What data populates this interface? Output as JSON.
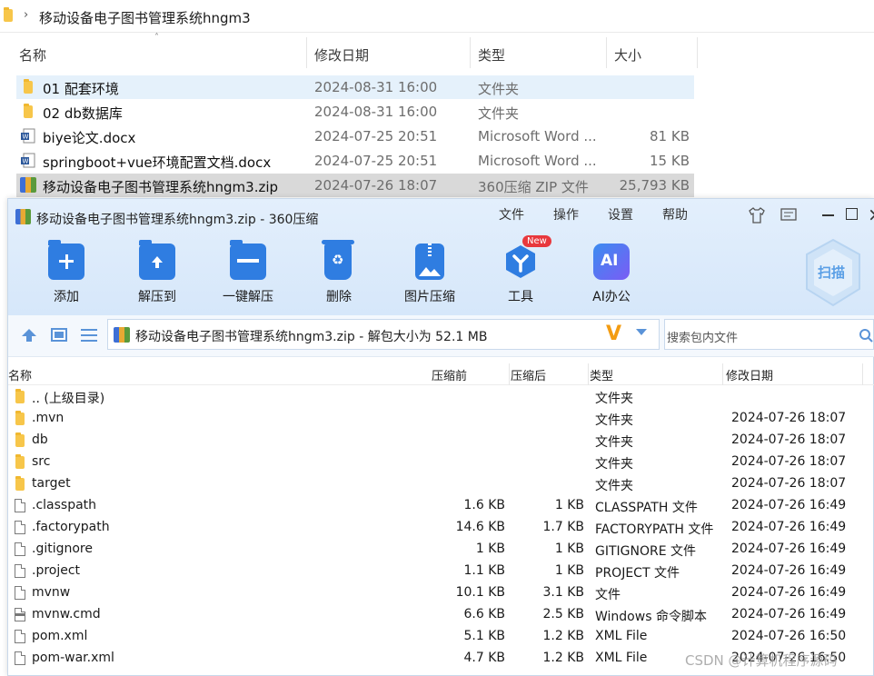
{
  "explorer": {
    "path": "移动设备电子图书管理系统hngm3",
    "columns": {
      "name": "名称",
      "date": "修改日期",
      "type": "类型",
      "size": "大小"
    },
    "rows": [
      {
        "name": "01 配套环境",
        "date": "2024-08-31 16:00",
        "type": "文件夹",
        "size": ""
      },
      {
        "name": "02 db数据库",
        "date": "2024-08-31 16:00",
        "type": "文件夹",
        "size": ""
      },
      {
        "name": "biye论文.docx",
        "date": "2024-07-25 20:51",
        "type": "Microsoft Word ...",
        "size": "81 KB"
      },
      {
        "name": "springboot+vue环境配置文档.docx",
        "date": "2024-07-25 20:51",
        "type": "Microsoft Word ...",
        "size": "15 KB"
      },
      {
        "name": "移动设备电子图书管理系统hngm3.zip",
        "date": "2024-07-26 18:07",
        "type": "360压缩 ZIP 文件",
        "size": "25,793 KB"
      }
    ]
  },
  "app": {
    "title": "移动设备电子图书管理系统hngm3.zip - 360压缩",
    "menu": [
      "文件",
      "操作",
      "设置",
      "帮助"
    ],
    "toolbar": [
      {
        "label": "添加",
        "icon": "add-icon"
      },
      {
        "label": "解压到",
        "icon": "extract-to-icon"
      },
      {
        "label": "一键解压",
        "icon": "one-click-extract-icon"
      },
      {
        "label": "删除",
        "icon": "delete-icon"
      },
      {
        "label": "图片压缩",
        "icon": "image-compress-icon"
      },
      {
        "label": "工具",
        "icon": "tools-icon",
        "badge": "New"
      },
      {
        "label": "AI办公",
        "icon": "ai-office-icon",
        "glyph": "AI"
      }
    ],
    "scan_label": "扫描",
    "address": "移动设备电子图书管理系统hngm3.zip - 解包大小为 52.1 MB",
    "search_placeholder": "搜索包内文件",
    "columns": {
      "name": "名称",
      "before": "压缩前",
      "after": "压缩后",
      "type": "类型",
      "date": "修改日期"
    },
    "rows": [
      {
        "name": ".. (上级目录)",
        "before": "",
        "after": "",
        "type": "文件夹",
        "date": "",
        "kind": "folder"
      },
      {
        "name": ".mvn",
        "before": "",
        "after": "",
        "type": "文件夹",
        "date": "2024-07-26 18:07",
        "kind": "folder"
      },
      {
        "name": "db",
        "before": "",
        "after": "",
        "type": "文件夹",
        "date": "2024-07-26 18:07",
        "kind": "folder"
      },
      {
        "name": "src",
        "before": "",
        "after": "",
        "type": "文件夹",
        "date": "2024-07-26 18:07",
        "kind": "folder"
      },
      {
        "name": "target",
        "before": "",
        "after": "",
        "type": "文件夹",
        "date": "2024-07-26 18:07",
        "kind": "folder"
      },
      {
        "name": ".classpath",
        "before": "1.6 KB",
        "after": "1 KB",
        "type": "CLASSPATH 文件",
        "date": "2024-07-26 16:49",
        "kind": "file"
      },
      {
        "name": ".factorypath",
        "before": "14.6 KB",
        "after": "1.7 KB",
        "type": "FACTORYPATH 文件",
        "date": "2024-07-26 16:49",
        "kind": "file"
      },
      {
        "name": ".gitignore",
        "before": "1 KB",
        "after": "1 KB",
        "type": "GITIGNORE 文件",
        "date": "2024-07-26 16:49",
        "kind": "file"
      },
      {
        "name": ".project",
        "before": "1.1 KB",
        "after": "1 KB",
        "type": "PROJECT 文件",
        "date": "2024-07-26 16:49",
        "kind": "file"
      },
      {
        "name": "mvnw",
        "before": "10.1 KB",
        "after": "3.1 KB",
        "type": "文件",
        "date": "2024-07-26 16:49",
        "kind": "file"
      },
      {
        "name": "mvnw.cmd",
        "before": "6.6 KB",
        "after": "2.5 KB",
        "type": "Windows 命令脚本",
        "date": "2024-07-26 16:49",
        "kind": "cmd"
      },
      {
        "name": "pom.xml",
        "before": "5.1 KB",
        "after": "1.2 KB",
        "type": "XML File",
        "date": "2024-07-26 16:50",
        "kind": "file"
      },
      {
        "name": "pom-war.xml",
        "before": "4.7 KB",
        "after": "1.2 KB",
        "type": "XML File",
        "date": "2024-07-26 16:50",
        "kind": "file"
      }
    ]
  },
  "watermark": "CSDN @计算机程序源码",
  "colors": {
    "selected": "#d9d9d9",
    "hover": "#e5f1fb",
    "app_header": "#dcebfb",
    "accent": "#2f7de1"
  }
}
